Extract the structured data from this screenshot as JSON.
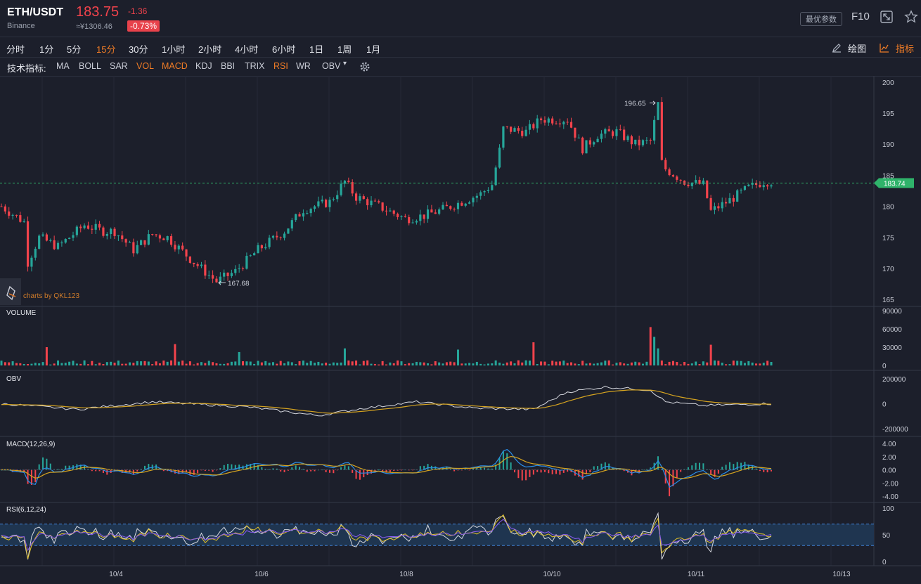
{
  "header": {
    "symbol": "ETH/USDT",
    "exchange": "Binance",
    "price": "183.75",
    "price_cny": "≈¥1306.46",
    "change": "-1.36",
    "change_pct": "-0.73%",
    "best_params_label": "最优参数",
    "f10_label": "F10",
    "colors": {
      "down": "#f2434c",
      "up": "#26a69a",
      "accent": "#f07c26"
    }
  },
  "timeframes": {
    "items": [
      "分时",
      "1分",
      "5分",
      "15分",
      "30分",
      "1小时",
      "2小时",
      "4小时",
      "6小时",
      "1日",
      "1周",
      "1月"
    ],
    "active": "15分",
    "draw_label": "绘图",
    "indicator_label": "指标"
  },
  "indicators": {
    "title": "技术指标:",
    "items": [
      "MA",
      "BOLL",
      "SAR",
      "VOL",
      "MACD",
      "KDJ",
      "BBI",
      "TRIX",
      "RSI",
      "WR",
      "OBV"
    ],
    "active": [
      "VOL",
      "MACD",
      "RSI"
    ],
    "settings_icon": "gear-icon"
  },
  "chart_data": [
    {
      "panel": "price",
      "type": "candlestick",
      "watermark": "charts by QKL123",
      "x_ticks": [
        "10/4",
        "10/6",
        "10/8",
        "10/10",
        "10/11",
        "10/13"
      ],
      "y_ticks": [
        165,
        170,
        175,
        180,
        185,
        190,
        195,
        200
      ],
      "ylim": [
        164,
        201
      ],
      "last_price": 183.74,
      "high_marker": {
        "label": "196.65",
        "value": 196.65
      },
      "low_marker": {
        "label": "167.68",
        "value": 167.68
      },
      "approx_path": [
        [
          0,
          180
        ],
        [
          6,
          177.5
        ],
        [
          7,
          171
        ],
        [
          10,
          175
        ],
        [
          15,
          173.5
        ],
        [
          22,
          177
        ],
        [
          27,
          176
        ],
        [
          30,
          176
        ],
        [
          35,
          173
        ],
        [
          40,
          175.5
        ],
        [
          44,
          175
        ],
        [
          51,
          171
        ],
        [
          57,
          167.9
        ],
        [
          62,
          169.5
        ],
        [
          68,
          173
        ],
        [
          75,
          176
        ],
        [
          80,
          179.5
        ],
        [
          87,
          180.7
        ],
        [
          91,
          184
        ],
        [
          94,
          181.5
        ],
        [
          100,
          180
        ],
        [
          107,
          178
        ],
        [
          112,
          178.5
        ],
        [
          117,
          179.5
        ],
        [
          121,
          180.5
        ],
        [
          127,
          182
        ],
        [
          130,
          183.5
        ],
        [
          132,
          189
        ],
        [
          133,
          192.5
        ],
        [
          139,
          192
        ],
        [
          143,
          194
        ],
        [
          150,
          194
        ],
        [
          154,
          189.3
        ],
        [
          158,
          191.5
        ],
        [
          163,
          192
        ],
        [
          168,
          190
        ],
        [
          172,
          190.5
        ],
        [
          174,
          196.5
        ],
        [
          175,
          187
        ],
        [
          176,
          186
        ],
        [
          181,
          184
        ],
        [
          186,
          183.5
        ],
        [
          188,
          179.2
        ],
        [
          193,
          181
        ],
        [
          198,
          183
        ],
        [
          202,
          184
        ]
      ]
    },
    {
      "panel": "volume",
      "type": "bar",
      "title": "VOLUME",
      "y_ticks": [
        0,
        30000,
        60000,
        90000
      ],
      "ylim": [
        0,
        90000
      ]
    },
    {
      "panel": "obv",
      "type": "line",
      "title": "OBV",
      "y_ticks": [
        -200000,
        0,
        200000
      ],
      "ylim": [
        -200000,
        200000
      ]
    },
    {
      "panel": "macd",
      "type": "line",
      "title": "MACD(12,26,9)",
      "y_ticks": [
        "-4.00",
        "-2.00",
        "0.00",
        "2.00",
        "4.00"
      ],
      "ylim": [
        -4,
        4
      ]
    },
    {
      "panel": "rsi",
      "type": "line",
      "title": "RSI(6,12,24)",
      "y_ticks": [
        0,
        50,
        100
      ],
      "ylim": [
        0,
        100
      ],
      "band": [
        30,
        70
      ]
    }
  ]
}
